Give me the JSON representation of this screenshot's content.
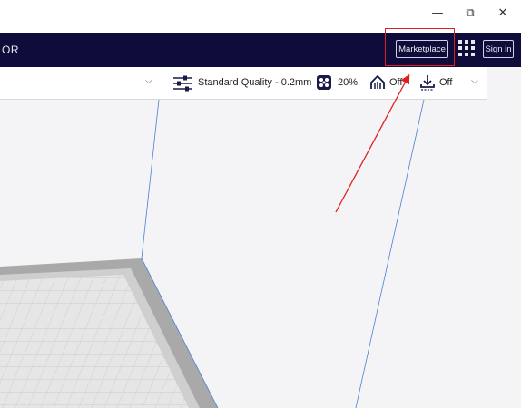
{
  "window": {
    "minimize_glyph": "—",
    "maximize_glyph": "⧉",
    "close_glyph": "✕"
  },
  "header": {
    "app_label": "OR",
    "marketplace_label": "Marketplace",
    "apps_icon": "grid-icon",
    "signin_label": "Sign in"
  },
  "toolbar": {
    "settings_icon": "sliders-icon",
    "profile_label": "Standard Quality - 0.2mm",
    "infill_icon": "infill-icon",
    "infill_value": "20%",
    "support_icon": "support-icon",
    "support_value": "Off",
    "adhesion_icon": "adhesion-icon",
    "adhesion_value": "Off"
  },
  "colors": {
    "header_bg": "#0d0c3a",
    "annotation": "#e02020",
    "build_edge": "#4a7fd4"
  }
}
